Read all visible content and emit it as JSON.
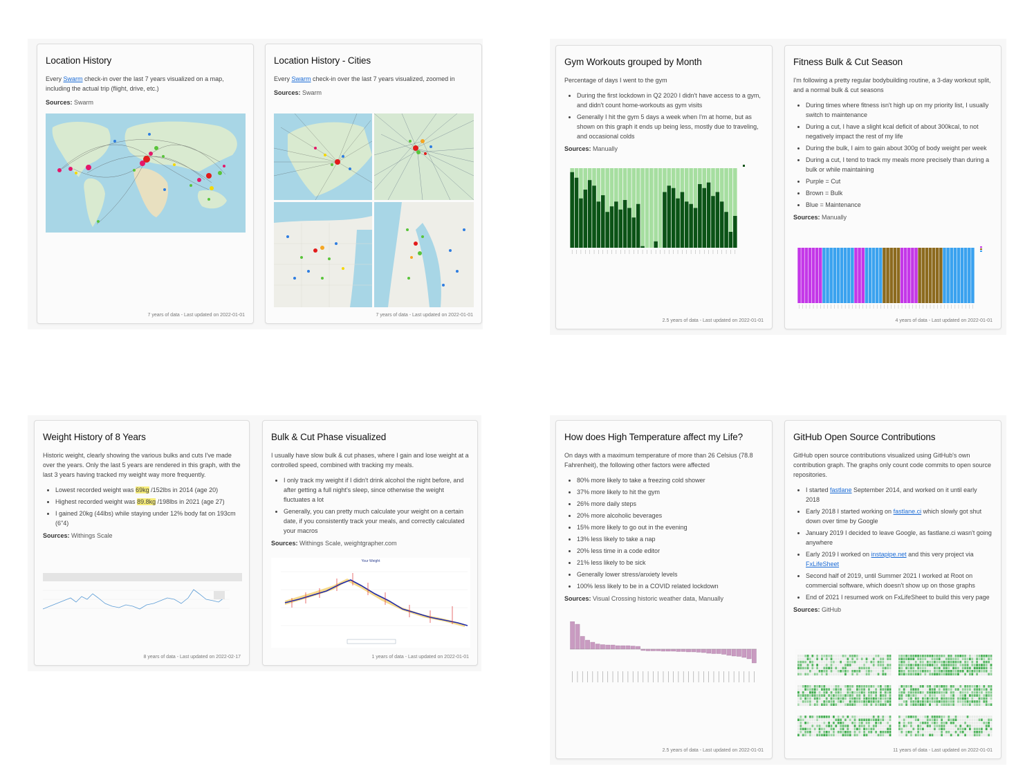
{
  "cards": {
    "location": {
      "title": "Location History",
      "desc_pre": "Every ",
      "desc_link": "Swarm",
      "desc_post": " check-in over the last 7 years visualized on a map, including the actual trip (flight, drive, etc.)",
      "sources_label": "Sources:",
      "sources": "Swarm",
      "footer": "7 years of data - Last updated on 2022-01-01"
    },
    "cities": {
      "title": "Location History - Cities",
      "desc_pre": "Every ",
      "desc_link": "Swarm",
      "desc_post": " check-in over the last 7 years visualized, zoomed in",
      "sources_label": "Sources:",
      "sources": "Swarm",
      "footer": "7 years of data - Last updated on 2022-01-01"
    },
    "gym": {
      "title": "Gym Workouts grouped by Month",
      "desc": "Percentage of days I went to the gym",
      "bullets": [
        "During the first lockdown in Q2 2020 I didn't have access to a gym, and didn't count home-workouts as gym visits",
        "Generally I hit the gym 5 days a week when I'm at home, but as shown on this graph it ends up being less, mostly due to traveling, and occasional colds"
      ],
      "sources_label": "Sources:",
      "sources": "Manually",
      "footer": "2.5 years of data - Last updated on 2022-01-01"
    },
    "bulkcut": {
      "title": "Fitness Bulk & Cut Season",
      "desc": "I'm following a pretty regular bodybuilding routine, a 3-day workout split, and a normal bulk & cut seasons",
      "bullets": [
        "During times where fitness isn't high up on my priority list, I usually switch to maintenance",
        "During a cut, I have a slight kcal deficit of about 300kcal, to not negatively impact the rest of my life",
        "During the bulk, I aim to gain about 300g of body weight per week",
        "During a cut, I tend to track my meals more precisely than during a bulk or while maintaining",
        "Purple = Cut",
        "Brown = Bulk",
        "Blue = Maintenance"
      ],
      "sources_label": "Sources:",
      "sources": "Manually",
      "footer": "4 years of data - Last updated on 2022-01-01"
    },
    "weight": {
      "title": "Weight History of 8 Years",
      "desc": "Historic weight, clearly showing the various bulks and cuts I've made over the years. Only the last 5 years are rendered in this graph, with the last 3 years having tracked my weight way more frequently.",
      "b1_pre": "Lowest recorded weight was ",
      "b1_hl": "69kg",
      "b1_post": " /152lbs in 2014 (age 20)",
      "b2_pre": "Highest recorded weight was ",
      "b2_hl": "89.8kg",
      "b2_post": " /198lbs in 2021 (age 27)",
      "b3": "I gained 20kg (44lbs) while staying under 12% body fat on 193cm (6\"4)",
      "sources_label": "Sources:",
      "sources": "Withings Scale",
      "footer": "8 years of data - Last updated on 2022-02-17"
    },
    "phase": {
      "title": "Bulk & Cut Phase visualized",
      "desc": "I usually have slow bulk & cut phases, where I gain and lose weight at a controlled speed, combined with tracking my meals.",
      "bullets": [
        "I only track my weight if I didn't drink alcohol the night before, and after getting a full night's sleep, since otherwise the weight fluctuates a lot",
        "Generally, you can pretty much calculate your weight on a certain date, if you consistently track your meals, and correctly calculated your macros"
      ],
      "sources_label": "Sources:",
      "sources": "Withings Scale, weightgrapher.com",
      "chart_title": "Your Weight",
      "footer": "1 years of data - Last updated on 2022-01-01"
    },
    "temperature": {
      "title": "How does High Temperature affect my Life?",
      "desc": "On days with a maximum temperature of more than 26 Celsius (78.8 Fahrenheit), the following other factors were affected",
      "bullets": [
        "80% more likely to take a freezing cold shower",
        "37% more likely to hit the gym",
        "26% more daily steps",
        "20% more alcoholic beverages",
        "15% more likely to go out in the evening",
        "13% less likely to take a nap",
        "20% less time in a code editor",
        "21% less likely to be sick",
        "Generally lower stress/anxiety levels",
        "100% less likely to be in a COVID related lockdown"
      ],
      "sources_label": "Sources:",
      "sources": "Visual Crossing historic weather data, Manually",
      "footer": "2.5 years of data - Last updated on 2022-01-01"
    },
    "github": {
      "title": "GitHub Open Source Contributions",
      "desc": "GitHub open source contributions visualized using GitHub's own contribution graph. The graphs only count code commits to open source repositories.",
      "b1_pre": "I started ",
      "b1_link": "fastlane",
      "b1_post": " September 2014, and worked on it until early 2018",
      "b2_pre": "Early 2018 I started working on ",
      "b2_link": "fastlane.ci",
      "b2_post": " which slowly got shut down over time by Google",
      "b3": "January 2019 I decided to leave Google, as fastlane.ci wasn't going anywhere",
      "b4_pre": "Early 2019 I worked on ",
      "b4_link": "instapipe.net",
      "b4_mid": " and this very project via ",
      "b4_link2": "FxLifeSheet",
      "b5": "Second half of 2019, until Summer 2021 I worked at Root on commercial software, which doesn't show up on those graphs",
      "b6": "End of 2021 I resumed work on FxLifeSheet to build this very page",
      "sources_label": "Sources:",
      "sources": "GitHub",
      "footer": "11 years of data - Last updated on 2022-01-01"
    }
  },
  "colors": {
    "gym_dark": "#0b5316",
    "gym_light": "#a6dea0",
    "cut": "#c437e8",
    "bulk": "#8c6a1e",
    "maintenance": "#3aa2ef",
    "temp_bar": "#c99bc1",
    "gh_green": "#3aaa48",
    "gh_empty": "#e8ece8"
  },
  "icons": {
    "map": "map-image",
    "legend": "legend-swatch"
  }
}
